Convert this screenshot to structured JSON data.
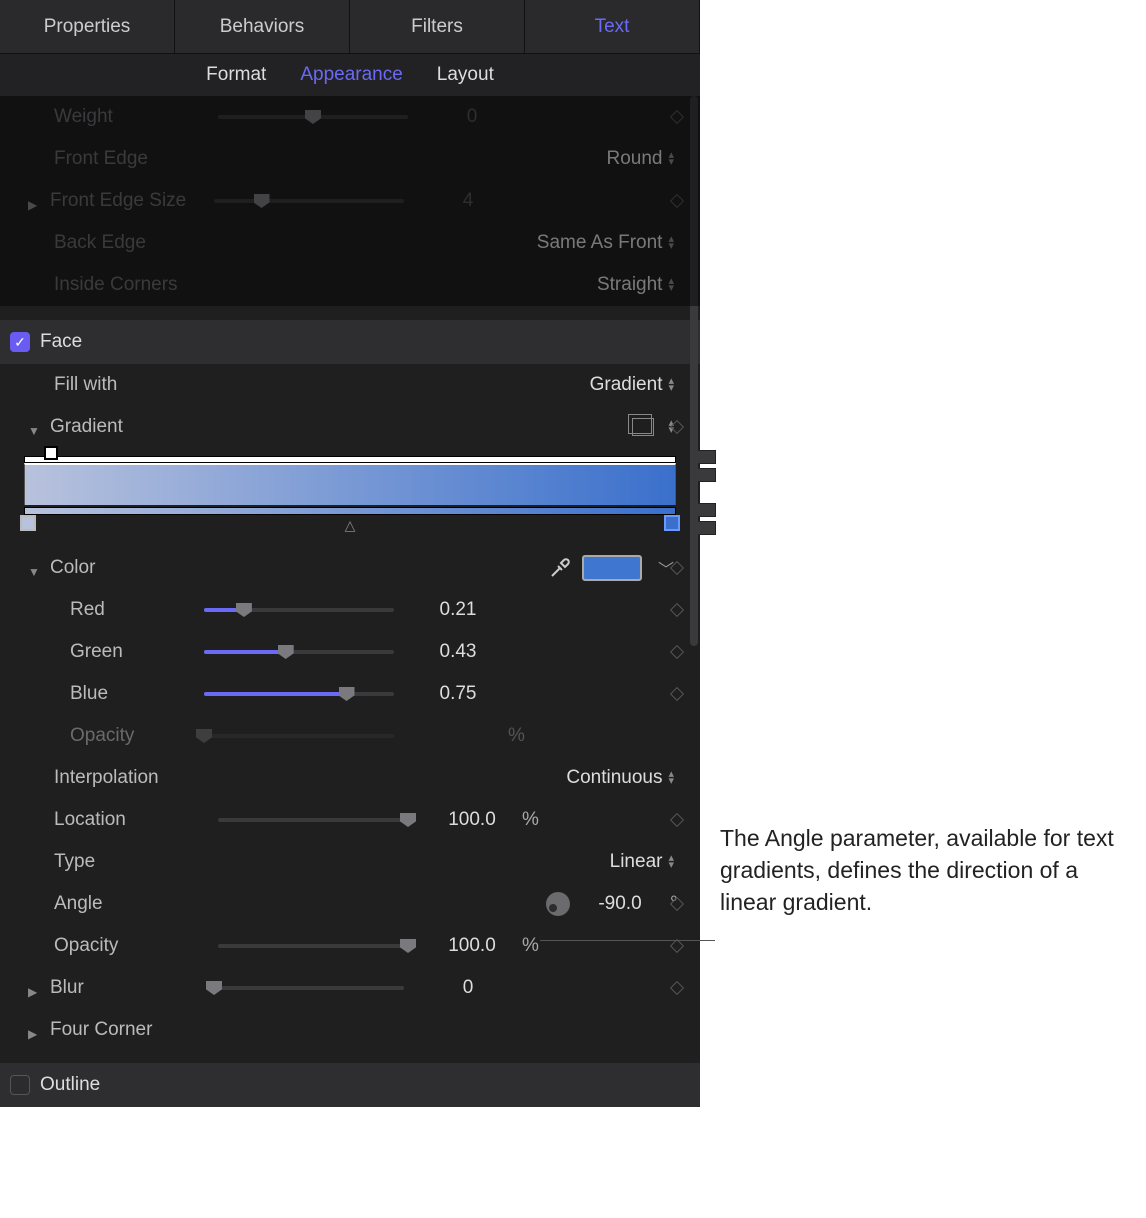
{
  "mainTabs": {
    "properties": "Properties",
    "behaviors": "Behaviors",
    "filters": "Filters",
    "text": "Text"
  },
  "subTabs": {
    "format": "Format",
    "appearance": "Appearance",
    "layout": "Layout"
  },
  "rows": {
    "weight": {
      "label": "Weight",
      "value": "0"
    },
    "frontEdge": {
      "label": "Front Edge",
      "value": "Round"
    },
    "frontEdgeSize": {
      "label": "Front Edge Size",
      "value": "4"
    },
    "backEdge": {
      "label": "Back Edge",
      "value": "Same As Front"
    },
    "insideCorners": {
      "label": "Inside Corners",
      "value": "Straight"
    }
  },
  "face": {
    "label": "Face"
  },
  "fillWith": {
    "label": "Fill with",
    "value": "Gradient"
  },
  "gradient": {
    "label": "Gradient"
  },
  "color": {
    "label": "Color",
    "red": {
      "label": "Red",
      "value": "0.21",
      "pct": 21
    },
    "green": {
      "label": "Green",
      "value": "0.43",
      "pct": 43
    },
    "blue": {
      "label": "Blue",
      "value": "0.75",
      "pct": 75
    },
    "opacity": {
      "label": "Opacity",
      "unit": "%"
    }
  },
  "interpolation": {
    "label": "Interpolation",
    "value": "Continuous"
  },
  "location": {
    "label": "Location",
    "value": "100.0",
    "unit": "%",
    "pct": 100
  },
  "type": {
    "label": "Type",
    "value": "Linear"
  },
  "angle": {
    "label": "Angle",
    "value": "-90.0",
    "unit": "°"
  },
  "opacity2": {
    "label": "Opacity",
    "value": "100.0",
    "unit": "%",
    "pct": 100
  },
  "blur": {
    "label": "Blur",
    "value": "0",
    "pct": 0
  },
  "fourCorner": {
    "label": "Four Corner"
  },
  "outline": {
    "label": "Outline"
  },
  "annotation": "The Angle parameter, available for text gradients, defines the direction of a linear gradient."
}
